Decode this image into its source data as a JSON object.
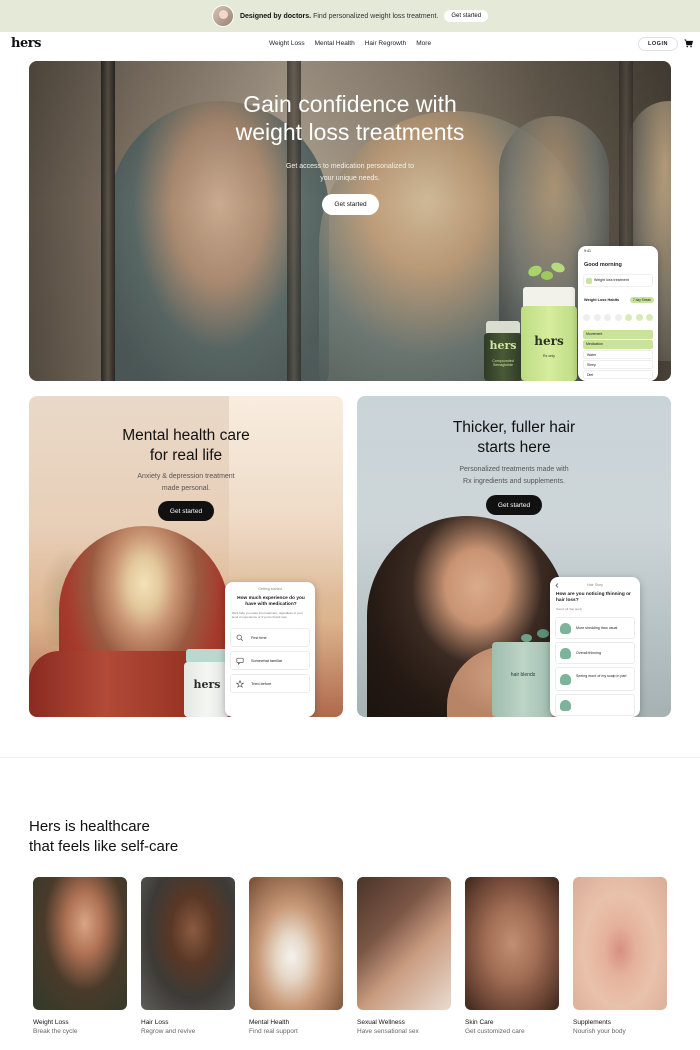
{
  "promo": {
    "bold_text": "Designed by doctors.",
    "text": " Find personalized weight loss treatment.",
    "button": "Get started"
  },
  "header": {
    "logo": "hers",
    "nav": [
      "Weight Loss",
      "Mental Health",
      "Hair Regrowth",
      "More"
    ],
    "login": "LOGIN"
  },
  "hero": {
    "title_line1": "Gain confidence with",
    "title_line2": "weight loss treatments",
    "subtitle_line1": "Get access to medication personalized to",
    "subtitle_line2": "your unique needs.",
    "button": "Get started",
    "phone": {
      "time": "9:41",
      "greeting": "Good morning",
      "card_text": "Weight loss treatment",
      "section": "Weight Loss Habits",
      "badge": "7 day Streak",
      "rows": [
        "Movement",
        "Medication",
        "Water",
        "Sleep",
        "Diet"
      ]
    },
    "bottle_label_small": "hers",
    "bottle_label_big": "hers",
    "bottle_small_caption": "Compounded Semaglutide",
    "bottle_big_caption": "Rx only"
  },
  "mental_health": {
    "title_line1": "Mental health care",
    "title_line2": "for real life",
    "subtitle_line1": "Anxiety & depression treatment",
    "subtitle_line2": "made personal.",
    "button": "Get started",
    "bottle_label": "hers",
    "phone": {
      "header": "Getting started",
      "question": "How much experience do you have with medication?",
      "note": "We'll help you ease into treatment, regardless of your level of experience or if you're brand new.",
      "options": [
        "First time",
        "Somewhat familiar",
        "Tried before"
      ]
    }
  },
  "hair": {
    "title_line1": "Thicker, fuller hair",
    "title_line2": "starts here",
    "subtitle_line1": "Personalized treatments made with",
    "subtitle_line2": "Rx ingredients and supplements.",
    "button": "Get started",
    "bottle_label": "hair blends",
    "phone": {
      "header": "Hair Story",
      "question": "How are you noticing thinning or hair loss?",
      "note": "Select all that apply",
      "options": [
        "More shedding than usual",
        "Overall thinning",
        "Seeing more of my scalp in part"
      ]
    }
  },
  "section": {
    "title_line1": "Hers is healthcare",
    "title_line2": "that feels like self-care"
  },
  "categories": [
    {
      "name": "Weight Loss",
      "desc": "Break the cycle"
    },
    {
      "name": "Hair Loss",
      "desc": "Regrow and revive"
    },
    {
      "name": "Mental Health",
      "desc": "Find real support"
    },
    {
      "name": "Sexual Wellness",
      "desc": "Have sensational sex"
    },
    {
      "name": "Skin Care",
      "desc": "Get customized care"
    },
    {
      "name": "Supplements",
      "desc": "Nourish your body"
    }
  ],
  "colors": {
    "promo_bg": "#e4ead7",
    "accent_green": "#c9e39a",
    "button_dark": "#111111"
  }
}
